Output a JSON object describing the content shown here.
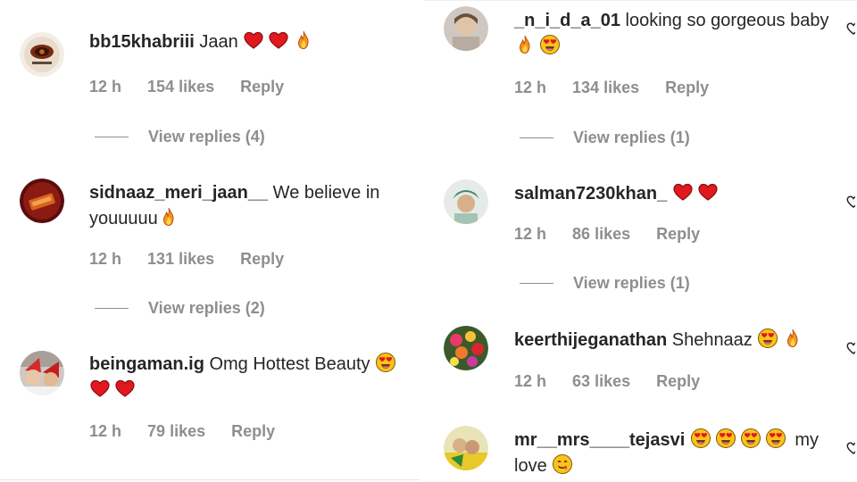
{
  "left_column": [
    {
      "username": "bb15khabriii",
      "text": " Jaan ",
      "emojis": [
        "red-heart",
        "red-heart",
        "fire"
      ],
      "time": "12 h",
      "likes": "154 likes",
      "reply_label": "Reply",
      "view_replies": "View replies (4)"
    },
    {
      "username": "sidnaaz_meri_jaan__",
      "text": " We believe in youuuuu",
      "emojis": [
        "fire"
      ],
      "time": "12 h",
      "likes": "131 likes",
      "reply_label": "Reply",
      "view_replies": "View replies (2)"
    },
    {
      "username": "beingaman.ig",
      "text": " Omg Hottest Beauty ",
      "emojis": [
        "heart-eyes",
        "red-heart",
        "red-heart"
      ],
      "time": "12 h",
      "likes": "79 likes",
      "reply_label": "Reply"
    }
  ],
  "right_column": [
    {
      "username": "_n_i_d_a_01",
      "text": " looking so gorgeous baby",
      "emojis": [
        "fire",
        "heart-eyes"
      ],
      "time": "12 h",
      "likes": "134 likes",
      "reply_label": "Reply",
      "view_replies": "View replies (1)"
    },
    {
      "username": "salman7230khan_",
      "text": " ",
      "emojis": [
        "red-heart",
        "red-heart"
      ],
      "time": "12 h",
      "likes": "86 likes",
      "reply_label": "Reply",
      "view_replies": "View replies (1)"
    },
    {
      "username": "keerthijeganathan",
      "text": " Shehnaaz ",
      "emojis": [
        "heart-eyes",
        "fire"
      ],
      "time": "12 h",
      "likes": "63 likes",
      "reply_label": "Reply"
    },
    {
      "username": "mr__mrs____tejasvi",
      "text_before": " ",
      "emojis": [
        "heart-eyes",
        "heart-eyes",
        "heart-eyes",
        "heart-eyes"
      ],
      "text_after": " my love ",
      "emojis_after": [
        "face-savoring"
      ]
    }
  ],
  "colors": {
    "primary_text": "#262626",
    "secondary_text": "#8e8e8e",
    "heart": "#ed1c24",
    "fire": "#f7941d",
    "emoji_face": "#fcc21b"
  },
  "icons": [
    "heart-outline-icon"
  ]
}
